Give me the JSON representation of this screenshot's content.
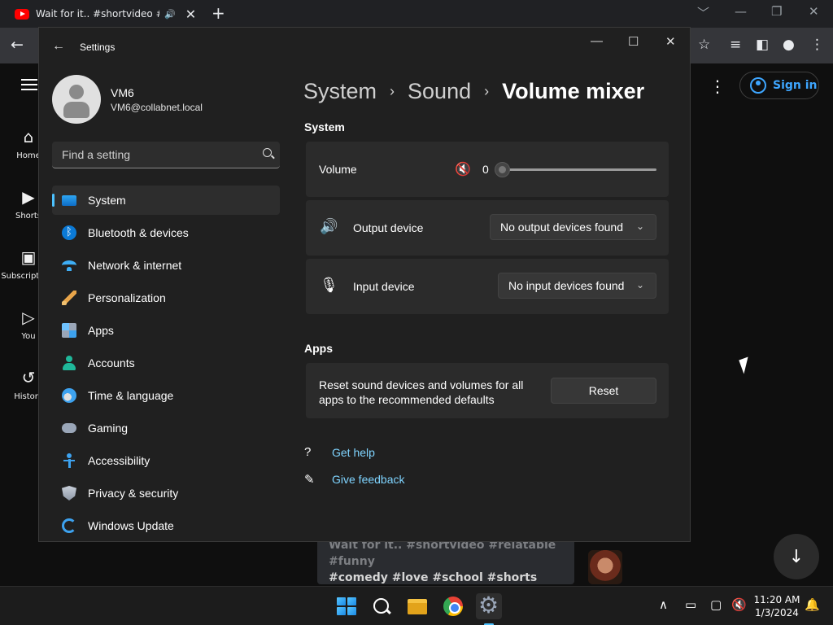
{
  "browser": {
    "tab_title": "Wait for it.. #shortvideo #relatable",
    "tab_speaker": "🔊",
    "tab_close": "✕",
    "new_tab": "+",
    "window_min": "﹀",
    "window_minimize": "—",
    "window_restore": "❐",
    "window_close": "✕",
    "back": "←",
    "bookmark_star": "☆",
    "media": "≡",
    "side_panel": "◧",
    "profile": "●",
    "menu": "⋮"
  },
  "youtube": {
    "nav": [
      {
        "label": "Home",
        "icon": "⌂"
      },
      {
        "label": "Shorts",
        "icon": "▶"
      },
      {
        "label": "Subscriptions",
        "icon": "▣"
      },
      {
        "label": "You",
        "icon": "▷"
      },
      {
        "label": "History",
        "icon": "↺"
      }
    ],
    "more": "⋮",
    "sign_in": "Sign in",
    "caption_line1": "Wait for it.. #shortvideo #relatable #funny",
    "caption_line2": "#comedy #love #school #shorts #short",
    "scroll_down": "↓"
  },
  "settings": {
    "app_title": "Settings",
    "back": "←",
    "minimize": "—",
    "maximize": "☐",
    "close": "✕",
    "profile_name": "VM6",
    "profile_email": "VM6@collabnet.local",
    "search_placeholder": "Find a setting",
    "nav": [
      {
        "label": "System",
        "icon": "system-icon"
      },
      {
        "label": "Bluetooth & devices",
        "icon": "bluetooth-icon"
      },
      {
        "label": "Network & internet",
        "icon": "wifi-icon"
      },
      {
        "label": "Personalization",
        "icon": "brush-icon"
      },
      {
        "label": "Apps",
        "icon": "apps-icon"
      },
      {
        "label": "Accounts",
        "icon": "account-icon"
      },
      {
        "label": "Time & language",
        "icon": "globe-clock-icon"
      },
      {
        "label": "Gaming",
        "icon": "gamepad-icon"
      },
      {
        "label": "Accessibility",
        "icon": "accessibility-icon"
      },
      {
        "label": "Privacy & security",
        "icon": "shield-icon"
      },
      {
        "label": "Windows Update",
        "icon": "update-icon"
      }
    ],
    "active_nav": "System",
    "accent_color": "#4cc2ff",
    "breadcrumb": [
      "System",
      "Sound",
      "Volume mixer"
    ],
    "breadcrumb_sep": "›",
    "system_section": "System",
    "volume_label": "Volume",
    "volume_icon": "🔇",
    "volume_value": "0",
    "volume_level": 0,
    "output_icon": "🔊",
    "output_label": "Output device",
    "output_value": "No output devices found",
    "input_icon": "🎙",
    "input_label": "Input device",
    "input_value": "No input devices found",
    "chevron": "⌄",
    "apps_section": "Apps",
    "reset_text": "Reset sound devices and volumes for all apps to the recommended defaults",
    "reset_button": "Reset",
    "help_icon": "?",
    "get_help": "Get help",
    "feedback_icon": "✎",
    "give_feedback": "Give feedback"
  },
  "taskbar": {
    "tray_chevron": "∧",
    "tray_network_icon": "▭",
    "tray_monitor_icon": "▢",
    "tray_volume_icon": "🔇",
    "time": "11:20 AM",
    "date": "1/3/2024",
    "notification_icon": "🔔"
  }
}
